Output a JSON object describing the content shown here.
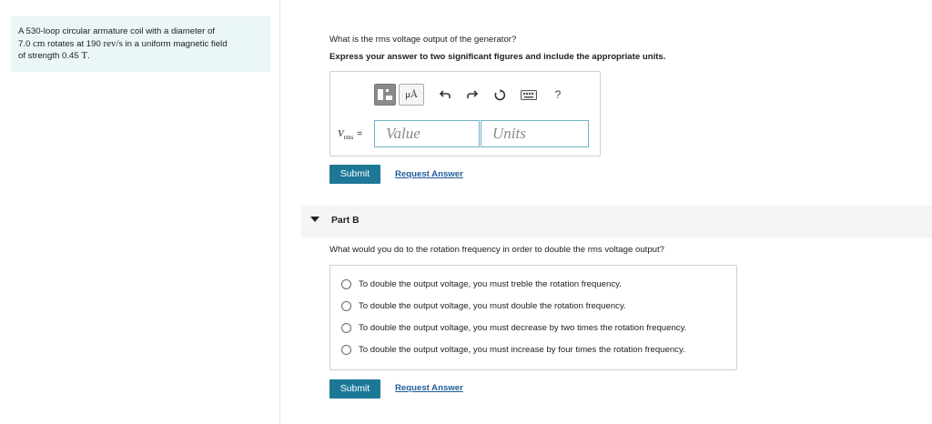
{
  "problem": {
    "line1": "A 530-loop circular armature coil with a diameter of",
    "line2_value": "7.0",
    "line2_unit": "cm",
    "line2_text": "rotates at 190",
    "line2_unit2": "rev/s",
    "line2_tail": "in a uniform magnetic field",
    "line3_text": "of strength 0.45",
    "line3_unit": "T",
    "line3_tail": "."
  },
  "partA": {
    "question": "What is the rms voltage output of the generator?",
    "hint": "Express your answer to two significant figures and include the appropriate units.",
    "toolbar": {
      "units_label": "μÅ",
      "help_label": "?"
    },
    "variable_label": "V",
    "variable_sub": "rms",
    "equals": "=",
    "value_placeholder": "Value",
    "units_placeholder": "Units",
    "submit_label": "Submit",
    "request_label": "Request Answer"
  },
  "partB": {
    "title": "Part B",
    "question": "What would you do to the rotation frequency in order to double the rms voltage output?",
    "options": [
      "To double the output voltage, you must treble the rotation frequency.",
      "To double the output voltage, you must double the rotation frequency.",
      "To double the output voltage, you must decrease by two times the rotation frequency.",
      "To double the output voltage, you must increase by four times the rotation frequency."
    ],
    "submit_label": "Submit",
    "request_label": "Request Answer"
  }
}
